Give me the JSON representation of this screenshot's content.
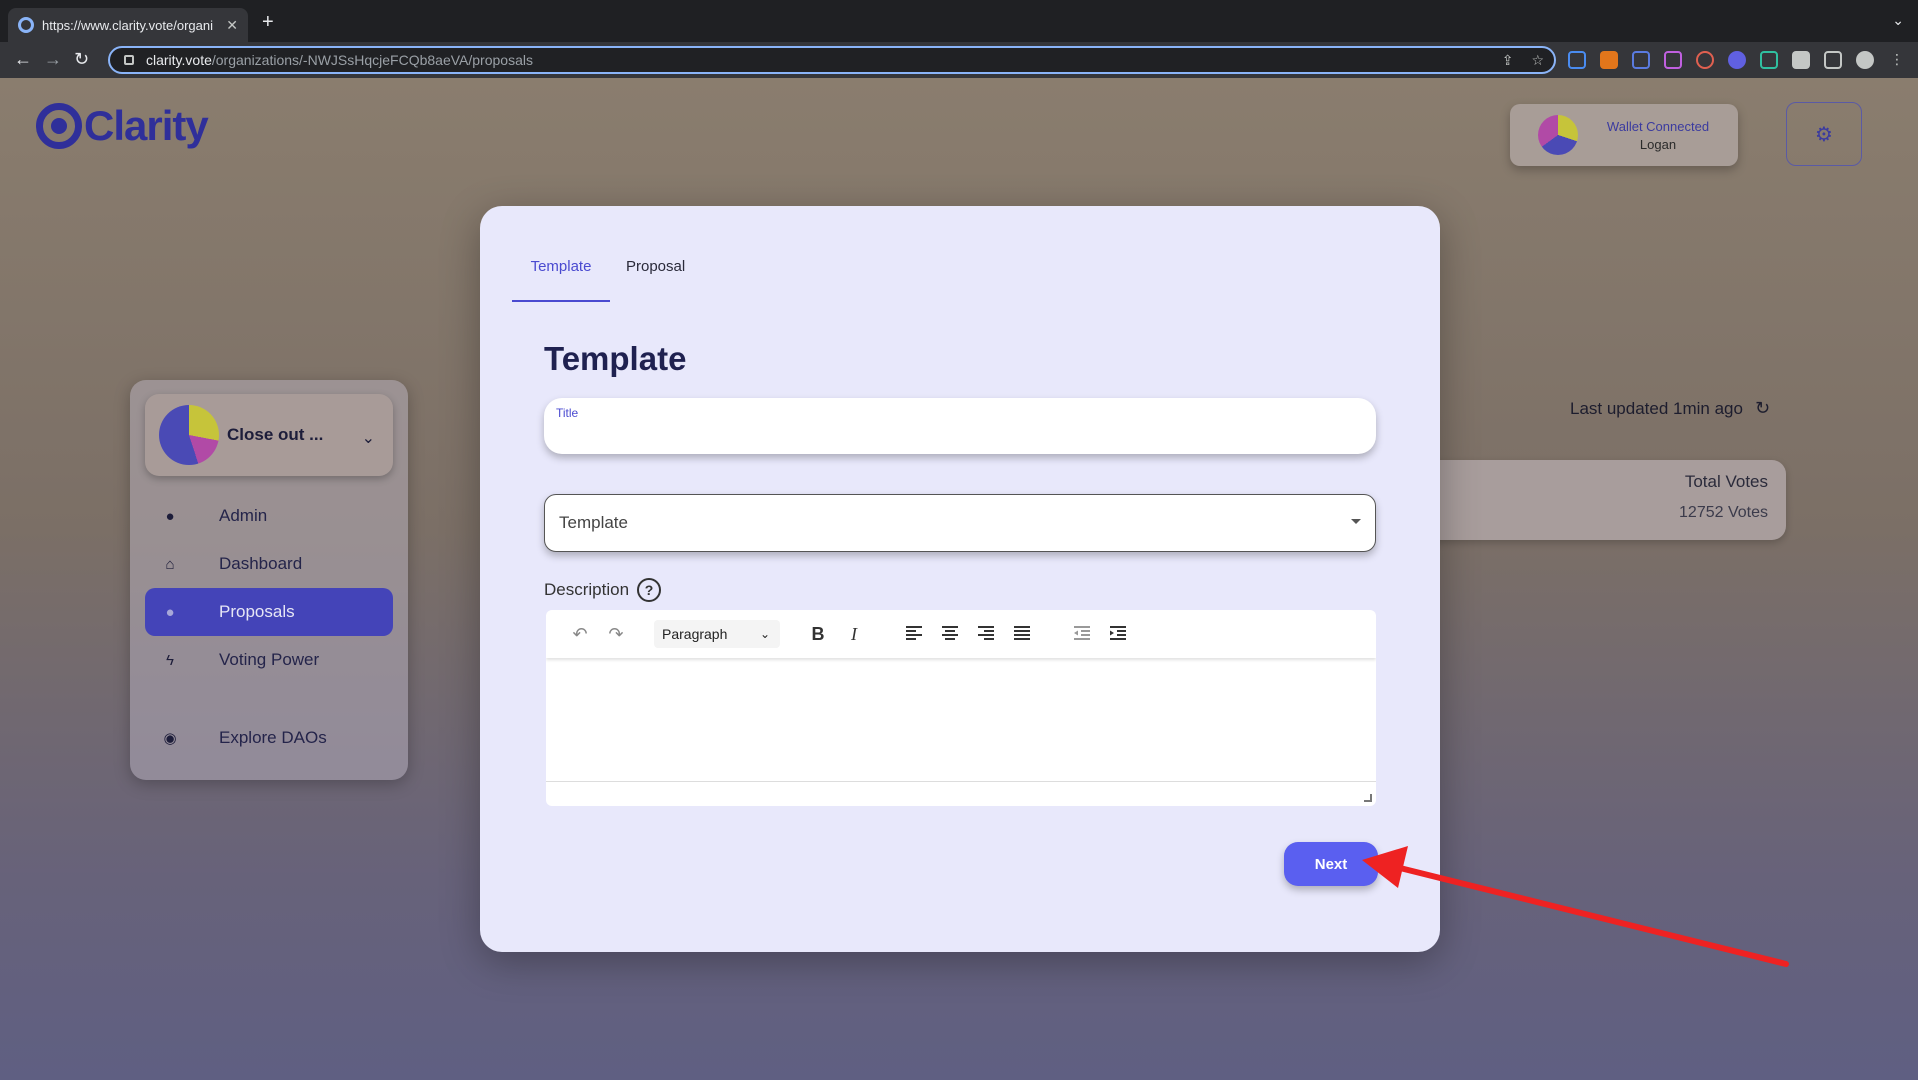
{
  "browser": {
    "tab_title": "https://www.clarity.vote/organi",
    "url_host": "clarity.vote",
    "url_path": "/organizations/-NWJSsHqcjeFCQb8aeVA/proposals"
  },
  "header": {
    "logo_text": "Clarity",
    "wallet_status": "Wallet Connected",
    "wallet_user": "Logan"
  },
  "sidebar": {
    "org_name": "Close out ...",
    "items": [
      {
        "label": "Admin",
        "icon": "person-icon"
      },
      {
        "label": "Dashboard",
        "icon": "home-icon"
      },
      {
        "label": "Proposals",
        "icon": "lightbulb-icon",
        "active": true
      },
      {
        "label": "Voting Power",
        "icon": "lightning-icon"
      },
      {
        "label": "Explore DAOs",
        "icon": "compass-icon"
      }
    ]
  },
  "stats": {
    "last_updated": "Last updated 1min ago",
    "total_votes_label": "Total Votes",
    "total_votes_value": "12752 Votes"
  },
  "modal": {
    "tabs": [
      "Template",
      "Proposal"
    ],
    "active_tab": "Template",
    "title": "Template",
    "title_field_label": "Title",
    "title_field_value": "",
    "template_select_value": "Template",
    "description_label": "Description",
    "editor_format": "Paragraph",
    "next_label": "Next"
  },
  "colors": {
    "accent": "#4a4ad0",
    "button": "#5a5ff0",
    "brand": "#2f2f9a",
    "annotation_arrow": "#ee2222"
  }
}
